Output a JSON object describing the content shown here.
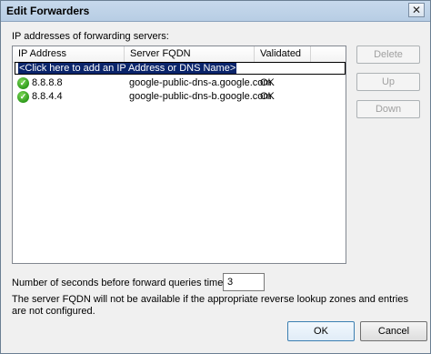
{
  "window": {
    "title": "Edit Forwarders",
    "close_glyph": "✕"
  },
  "list": {
    "label": "IP addresses of forwarding servers:",
    "columns": [
      "IP Address",
      "Server FQDN",
      "Validated"
    ],
    "add_prompt": "<Click here to add an IP Address or DNS Name>",
    "rows": [
      {
        "ip": "8.8.8.8",
        "fqdn": "google-public-dns-a.google.com",
        "validated": "OK",
        "status_icon": "green-check-icon"
      },
      {
        "ip": "8.8.4.4",
        "fqdn": "google-public-dns-b.google.com",
        "validated": "OK",
        "status_icon": "green-check-icon"
      }
    ]
  },
  "side_buttons": {
    "delete": "Delete",
    "up": "Up",
    "down": "Down"
  },
  "timeout": {
    "label": "Number of seconds before forward queries time out:",
    "value": "3"
  },
  "note": "The server FQDN will not be available if the appropriate reverse lookup zones and entries are not configured.",
  "footer": {
    "ok": "OK",
    "cancel": "Cancel"
  }
}
